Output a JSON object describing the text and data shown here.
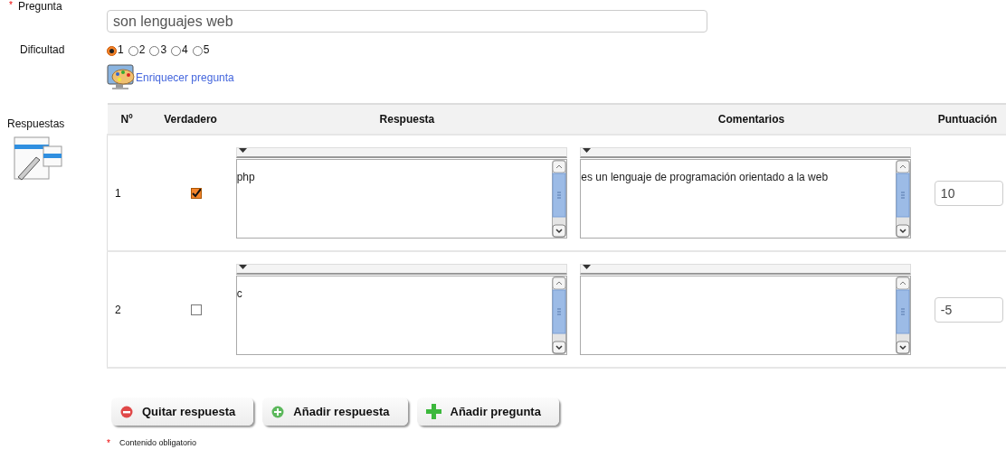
{
  "question": {
    "required_mark": "*",
    "label": "Pregunta",
    "value": "son lenguajes web"
  },
  "difficulty": {
    "label": "Dificultad",
    "options": [
      {
        "label": "1",
        "selected": true
      },
      {
        "label": "2",
        "selected": false
      },
      {
        "label": "3",
        "selected": false
      },
      {
        "label": "4",
        "selected": false
      },
      {
        "label": "5",
        "selected": false
      }
    ]
  },
  "enrich_link": "Enriquecer pregunta",
  "answers_label": "Respuestas",
  "table": {
    "columns": [
      "Nº",
      "Verdadero",
      "Respuesta",
      "Comentarios",
      "Puntuación"
    ],
    "rows": [
      {
        "number": "1",
        "checked": true,
        "answer": "php",
        "comment": "es un lenguaje de programación orientado a la web",
        "score": "10"
      },
      {
        "number": "2",
        "checked": false,
        "answer": "c",
        "score": "-5"
      }
    ]
  },
  "buttons": [
    {
      "kind": "remove",
      "label": "Quitar respuesta"
    },
    {
      "kind": "add",
      "label": "Añadir respuesta"
    },
    {
      "kind": "add-question",
      "label": "Añadir pregunta"
    }
  ],
  "footer": {
    "required_mark": "*",
    "text": "Contenido obligatorio"
  }
}
